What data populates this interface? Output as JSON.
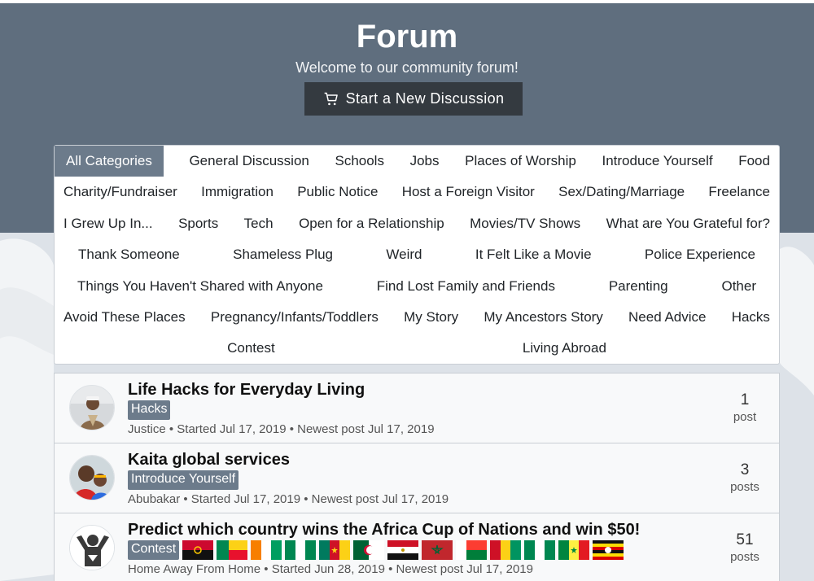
{
  "header": {
    "title": "Forum",
    "subtitle": "Welcome to our community forum!",
    "new_button_label": "Start a New Discussion"
  },
  "categories": {
    "row0": [
      "All Categories",
      "General Discussion",
      "Schools",
      "Jobs",
      "Places of Worship",
      "Introduce Yourself",
      "Food"
    ],
    "row1": [
      "Charity/Fundraiser",
      "Immigration",
      "Public Notice",
      "Host a Foreign Visitor",
      "Sex/Dating/Marriage",
      "Freelance"
    ],
    "row2": [
      "I Grew Up In...",
      "Sports",
      "Tech",
      "Open for a Relationship",
      "Movies/TV Shows",
      "What are You Grateful for?"
    ],
    "row3": [
      "Thank Someone",
      "Shameless Plug",
      "Weird",
      "It Felt Like a Movie",
      "Police Experience"
    ],
    "row4": [
      "Things You Haven't Shared with Anyone",
      "Find Lost Family and Friends",
      "Parenting",
      "Other"
    ],
    "row5": [
      "Avoid These Places",
      "Pregnancy/Infants/Toddlers",
      "My Story",
      "My Ancestors Story",
      "Need Advice",
      "Hacks"
    ],
    "row6": [
      "Contest",
      "Living Abroad"
    ],
    "active": "All Categories",
    "active_color": "#6c7b8b"
  },
  "topics": [
    {
      "title": "Life Hacks for Everyday Living",
      "tag": "Hacks",
      "meta": "Justice • Started Jul 17, 2019 • Newest post Jul 17, 2019",
      "count": "1",
      "count_label": "post"
    },
    {
      "title": "Kaita global services",
      "tag": "Introduce Yourself",
      "meta": "Abubakar • Started Jul 17, 2019 • Newest post Jul 17, 2019",
      "count": "3",
      "count_label": "posts"
    },
    {
      "title": "Predict which country wins the Africa Cup of Nations and win $50!",
      "tag": "Contest",
      "flags": [
        "angola-flag",
        "benin-flag",
        "ivory-coast-flag",
        "nigeria-flag",
        "cameroon-flag",
        "algeria-flag",
        "egypt-flag",
        "morocco-flag",
        "madagascar-flag",
        "guinea-flag",
        "nigeria-flag",
        "senegal-flag",
        "uganda-flag"
      ],
      "meta": "Home Away From Home • Started Jun 28, 2019 • Newest post Jul 17, 2019",
      "count": "51",
      "count_label": "posts"
    }
  ],
  "colors": {
    "hero": "#5f6e7e",
    "button": "#343a40",
    "tag": "#6c7b8b"
  }
}
